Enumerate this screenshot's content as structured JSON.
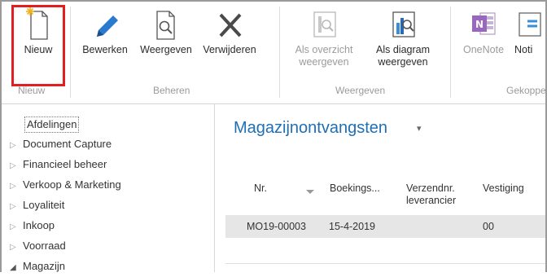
{
  "ribbon": {
    "buttons": {
      "nieuw": "Nieuw",
      "bewerken": "Bewerken",
      "weergeven": "Weergeven",
      "verwijderen": "Verwijderen",
      "als_overzicht_l1": "Als overzicht",
      "als_overzicht_l2": "weergeven",
      "als_diagram_l1": "Als diagram",
      "als_diagram_l2": "weergeven",
      "onenote": "OneNote",
      "notities": "Noti"
    },
    "groups": {
      "nieuw": "Nieuw",
      "beheren": "Beheren",
      "weergeven": "Weergeven",
      "gekoppeld": "Gekoppel"
    }
  },
  "nav": {
    "items": [
      {
        "label": "Afdelingen",
        "arrow": ""
      },
      {
        "label": "Document Capture",
        "arrow": "▷"
      },
      {
        "label": "Financieel beheer",
        "arrow": "▷"
      },
      {
        "label": "Verkoop & Marketing",
        "arrow": "▷"
      },
      {
        "label": "Loyaliteit",
        "arrow": "▷"
      },
      {
        "label": "Inkoop",
        "arrow": "▷"
      },
      {
        "label": "Voorraad",
        "arrow": "▷"
      },
      {
        "label": "Magazijn",
        "arrow": "◢"
      }
    ]
  },
  "page": {
    "title": "Magazijnontvangsten",
    "title_caret": "▾"
  },
  "table": {
    "headers": {
      "nr": "Nr.",
      "boekings": "Boekings...",
      "verzend_l1": "Verzendnr.",
      "verzend_l2": "leverancier",
      "vestiging": "Vestiging"
    },
    "rows": [
      {
        "nr": "MO19-00003",
        "boekings": "15-4-2019",
        "verzend": "",
        "vestiging": "00"
      }
    ]
  },
  "colors": {
    "accent": "#1e6fb4",
    "highlight_border": "#e02020",
    "pencil": "#2a7ad0",
    "delete_x": "#4a4a4a",
    "onenote": "#7a3b9f"
  }
}
